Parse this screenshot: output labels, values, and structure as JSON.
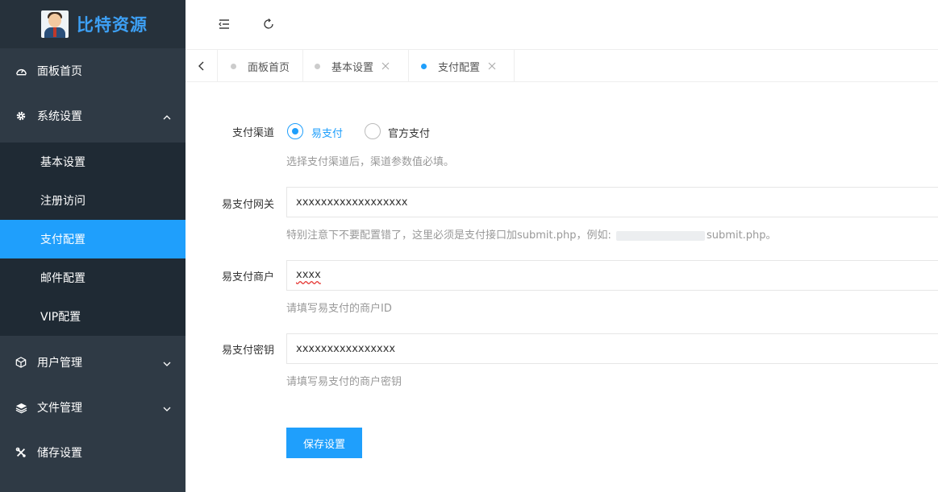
{
  "app": {
    "logo_text": "比特资源"
  },
  "sidebar": {
    "items": [
      {
        "label": "面板首页",
        "icon": "dashboard-icon"
      },
      {
        "label": "系统设置",
        "icon": "gear-icon",
        "expanded": true,
        "children": [
          {
            "label": "基本设置"
          },
          {
            "label": "注册访问"
          },
          {
            "label": "支付配置",
            "active": true
          },
          {
            "label": "邮件配置"
          },
          {
            "label": "VIP配置"
          }
        ]
      },
      {
        "label": "用户管理",
        "icon": "cube-icon"
      },
      {
        "label": "文件管理",
        "icon": "layers-icon"
      },
      {
        "label": "储存设置",
        "icon": "tools-icon"
      }
    ]
  },
  "tabs": [
    {
      "label": "面板首页"
    },
    {
      "label": "基本设置"
    },
    {
      "label": "支付配置",
      "active": true
    }
  ],
  "form": {
    "channel": {
      "label": "支付渠道",
      "options": [
        {
          "label": "易支付",
          "checked": true
        },
        {
          "label": "官方支付",
          "checked": false
        }
      ],
      "hint": "选择支付渠道后，渠道参数值必填。"
    },
    "gateway": {
      "label": "易支付网关",
      "value": "xxxxxxxxxxxxxxxxxx",
      "hint_prefix": "特别注意下不要配置错了，这里必须是支付接口加submit.php，例如: ",
      "hint_suffix": "submit.php。"
    },
    "merchant": {
      "label": "易支付商户",
      "value": "xxxx",
      "hint": "请填写易支付的商户ID"
    },
    "secret": {
      "label": "易支付密钥",
      "value": "xxxxxxxxxxxxxxxx",
      "hint": "请填写易支付的商户密钥"
    },
    "save_label": "保存设置"
  },
  "colors": {
    "sidebar_bg": "#2f3a45",
    "submenu_bg": "#1f2a34",
    "accent": "#1f9ffc"
  }
}
